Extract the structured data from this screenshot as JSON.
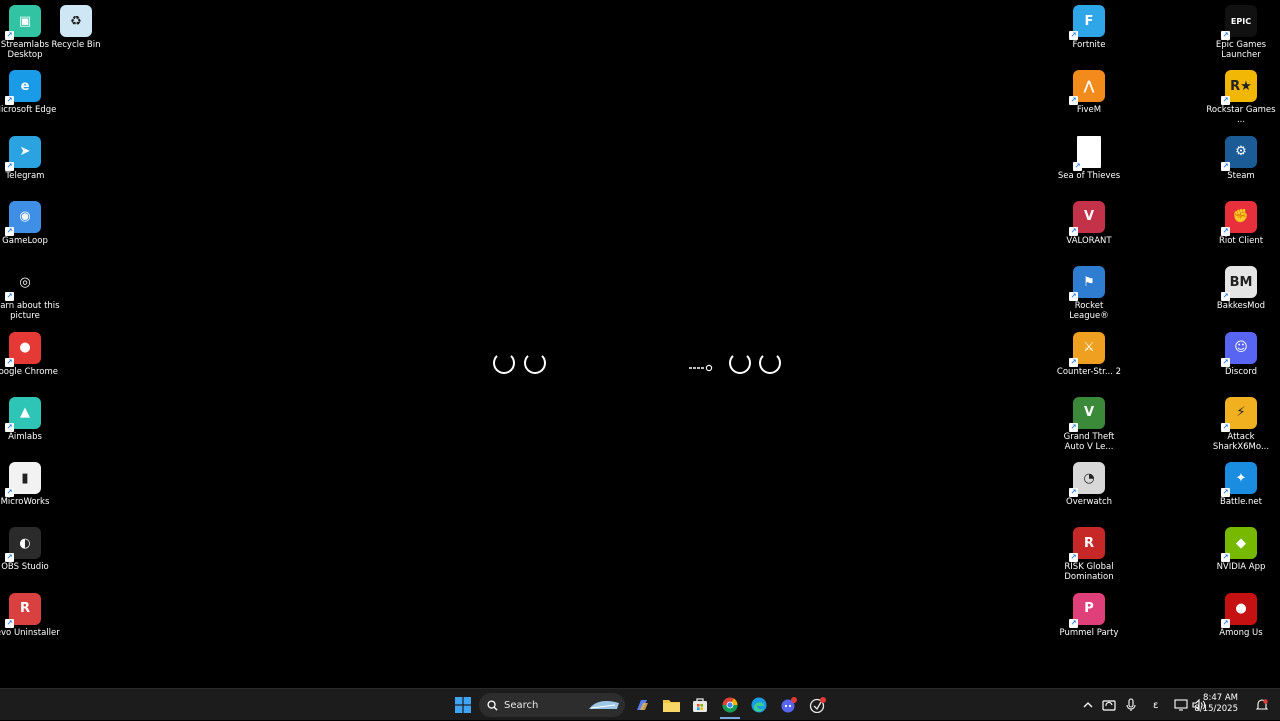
{
  "desktop": {
    "left_col_1": [
      {
        "label": "Streamlabs Desktop",
        "icon": "streamlabs-icon",
        "color": "#31c3a2"
      },
      {
        "label": "Microsoft Edge",
        "icon": "edge-icon",
        "color": "#1a9be8"
      },
      {
        "label": "Telegram",
        "icon": "telegram-icon",
        "color": "#2aa3e0"
      },
      {
        "label": "GameLoop",
        "icon": "gameloop-icon",
        "color": "#3f8fe6"
      },
      {
        "label": "Learn about this picture",
        "icon": "learn-picture-icon",
        "color": "#000000"
      },
      {
        "label": "Google Chrome",
        "icon": "chrome-icon",
        "color": "#e53935"
      },
      {
        "label": "Aimlabs",
        "icon": "aimlabs-icon",
        "color": "#2ec4b6"
      },
      {
        "label": "MicroWorks",
        "icon": "microworks-icon",
        "color": "#f2f2f2"
      },
      {
        "label": "OBS Studio",
        "icon": "obs-icon",
        "color": "#2b2b2b"
      },
      {
        "label": "Revo Uninstaller",
        "icon": "revo-icon",
        "color": "#d94040"
      }
    ],
    "left_col_2": [
      {
        "label": "Recycle Bin",
        "icon": "recycle-bin-icon",
        "color": "#cfe6f5"
      }
    ],
    "right_col_1": [
      {
        "label": "Fortnite",
        "icon": "fortnite-icon",
        "color": "#2fa6e8"
      },
      {
        "label": "FiveM",
        "icon": "fivem-icon",
        "color": "#f28a1c"
      },
      {
        "label": "Sea of Thieves",
        "icon": "sea-of-thieves-icon",
        "color": "#ffffff"
      },
      {
        "label": "VALORANT",
        "icon": "valorant-icon",
        "color": "#c4324a"
      },
      {
        "label": "Rocket League®",
        "icon": "rocket-league-icon",
        "color": "#2e7dd1"
      },
      {
        "label": "Counter-Str... 2",
        "icon": "counter-strike-icon",
        "color": "#f0a020"
      },
      {
        "label": "Grand Theft Auto V Le...",
        "icon": "gta-icon",
        "color": "#3a8a3a"
      },
      {
        "label": "Overwatch",
        "icon": "overwatch-icon",
        "color": "#d8d8d8"
      },
      {
        "label": "RISK Global Domination",
        "icon": "risk-icon",
        "color": "#c62828"
      },
      {
        "label": "Pummel Party",
        "icon": "pummel-party-icon",
        "color": "#e0407a"
      }
    ],
    "right_col_2": [
      {
        "label": "Epic Games Launcher",
        "icon": "epic-games-icon",
        "color": "#111111"
      },
      {
        "label": "Rockstar Games ...",
        "icon": "rockstar-icon",
        "color": "#f2b705"
      },
      {
        "label": "Steam",
        "icon": "steam-icon",
        "color": "#1b5c96"
      },
      {
        "label": "Riot Client",
        "icon": "riot-client-icon",
        "color": "#e8303c"
      },
      {
        "label": "BakkesMod",
        "icon": "bakkesmod-icon",
        "color": "#e5e5e5"
      },
      {
        "label": "Discord",
        "icon": "discord-icon",
        "color": "#5865f2"
      },
      {
        "label": "Attack SharkX6Mo...",
        "icon": "attack-shark-icon",
        "color": "#f0b020"
      },
      {
        "label": "Battle.net",
        "icon": "battlenet-icon",
        "color": "#1b8de0"
      },
      {
        "label": "NVIDIA App",
        "icon": "nvidia-icon",
        "color": "#76b900"
      },
      {
        "label": "Among Us",
        "icon": "among-us-icon",
        "color": "#c51111"
      }
    ]
  },
  "taskbar": {
    "search_label": "Search",
    "apps": [
      "windows-start-icon",
      "copilot-icon",
      "file-explorer-icon",
      "microsoft-store-icon",
      "chrome-icon",
      "edge-icon",
      "discord-icon",
      "riot-client-icon"
    ],
    "tray": {
      "ime": "ε",
      "time": "8:47 AM",
      "date": "8/15/2025"
    }
  }
}
